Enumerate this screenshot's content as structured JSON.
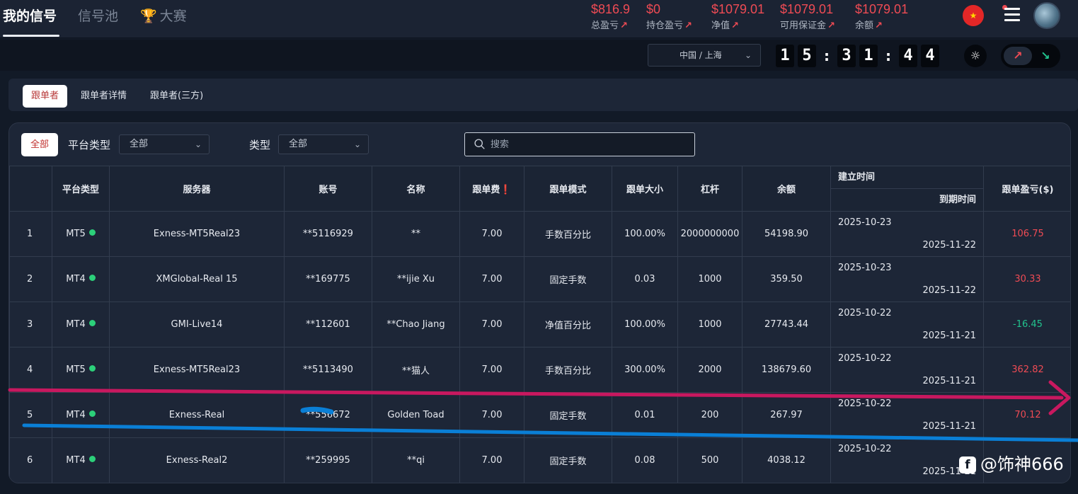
{
  "nav": {
    "tabs": [
      {
        "label": "我的信号",
        "active": true
      },
      {
        "label": "信号池",
        "active": false
      },
      {
        "label": "大赛",
        "active": false
      }
    ]
  },
  "stats": [
    {
      "value": "$816.9",
      "label": "总盈亏"
    },
    {
      "value": "$0",
      "label": "持仓盈亏"
    },
    {
      "value": "$1079.01",
      "label": "净值"
    },
    {
      "value": "$1079.01",
      "label": "可用保证金"
    },
    {
      "value": "$1079.01",
      "label": "余额"
    }
  ],
  "region": "中国 / 上海",
  "clock": [
    "1",
    "5",
    "3",
    "1",
    "4",
    "4"
  ],
  "sub_tabs": [
    {
      "label": "跟单者",
      "active": true
    },
    {
      "label": "跟单者详情",
      "active": false
    },
    {
      "label": "跟单者(三方)",
      "active": false
    }
  ],
  "filters": {
    "all_label": "全部",
    "platform_label": "平台类型",
    "platform_value": "全部",
    "type_label": "类型",
    "type_value": "全部",
    "search_placeholder": "搜索"
  },
  "table": {
    "headers": {
      "platform": "平台类型",
      "server": "服务器",
      "account": "账号",
      "name": "名称",
      "fee": "跟单费",
      "mode": "跟单模式",
      "size": "跟单大小",
      "leverage": "杠杆",
      "balance": "余额",
      "created": "建立时间",
      "expires": "到期时间",
      "pnl": "跟单盈亏($)"
    },
    "rows": [
      {
        "idx": "1",
        "platform": "MT5",
        "server": "Exness-MT5Real23",
        "account": "**5116929",
        "name": "**",
        "fee": "7.00",
        "mode": "手数百分比",
        "size": "100.00%",
        "leverage": "2000000000",
        "balance": "54198.90",
        "created": "2025-10-23",
        "expires": "2025-11-22",
        "pnl": "106.75",
        "pnl_sign": "pos"
      },
      {
        "idx": "2",
        "platform": "MT4",
        "server": "XMGlobal-Real 15",
        "account": "**169775",
        "name": "**ijie Xu",
        "fee": "7.00",
        "mode": "固定手数",
        "size": "0.03",
        "leverage": "1000",
        "balance": "359.50",
        "created": "2025-10-23",
        "expires": "2025-11-22",
        "pnl": "30.33",
        "pnl_sign": "pos"
      },
      {
        "idx": "3",
        "platform": "MT4",
        "server": "GMI-Live14",
        "account": "**112601",
        "name": "**Chao Jiang",
        "fee": "7.00",
        "mode": "净值百分比",
        "size": "100.00%",
        "leverage": "1000",
        "balance": "27743.44",
        "created": "2025-10-22",
        "expires": "2025-11-21",
        "pnl": "-16.45",
        "pnl_sign": "neg"
      },
      {
        "idx": "4",
        "platform": "MT5",
        "server": "Exness-MT5Real23",
        "account": "**5113490",
        "name": "**猫人",
        "fee": "7.00",
        "mode": "手数百分比",
        "size": "300.00%",
        "leverage": "2000",
        "balance": "138679.60",
        "created": "2025-10-22",
        "expires": "2025-11-21",
        "pnl": "362.82",
        "pnl_sign": "pos"
      },
      {
        "idx": "5",
        "platform": "MT4",
        "server": "Exness-Real",
        "account": "**556672",
        "name": "Golden Toad",
        "fee": "7.00",
        "mode": "固定手数",
        "size": "0.01",
        "leverage": "200",
        "balance": "267.97",
        "created": "2025-10-22",
        "expires": "2025-11-21",
        "pnl": "70.12",
        "pnl_sign": "pos"
      },
      {
        "idx": "6",
        "platform": "MT4",
        "server": "Exness-Real2",
        "account": "**259995",
        "name": "**qi",
        "fee": "7.00",
        "mode": "固定手数",
        "size": "0.08",
        "leverage": "500",
        "balance": "4038.12",
        "created": "2025-10-22",
        "expires": "2025-11-21",
        "pnl": "",
        "pnl_sign": "pos"
      }
    ]
  },
  "watermark": "@饰神666",
  "colors": {
    "profit": "#ef4b54",
    "loss": "#22c38e",
    "online": "#2cd07a",
    "annotation_magenta": "#c8185f",
    "annotation_blue": "#0a7fd6"
  }
}
